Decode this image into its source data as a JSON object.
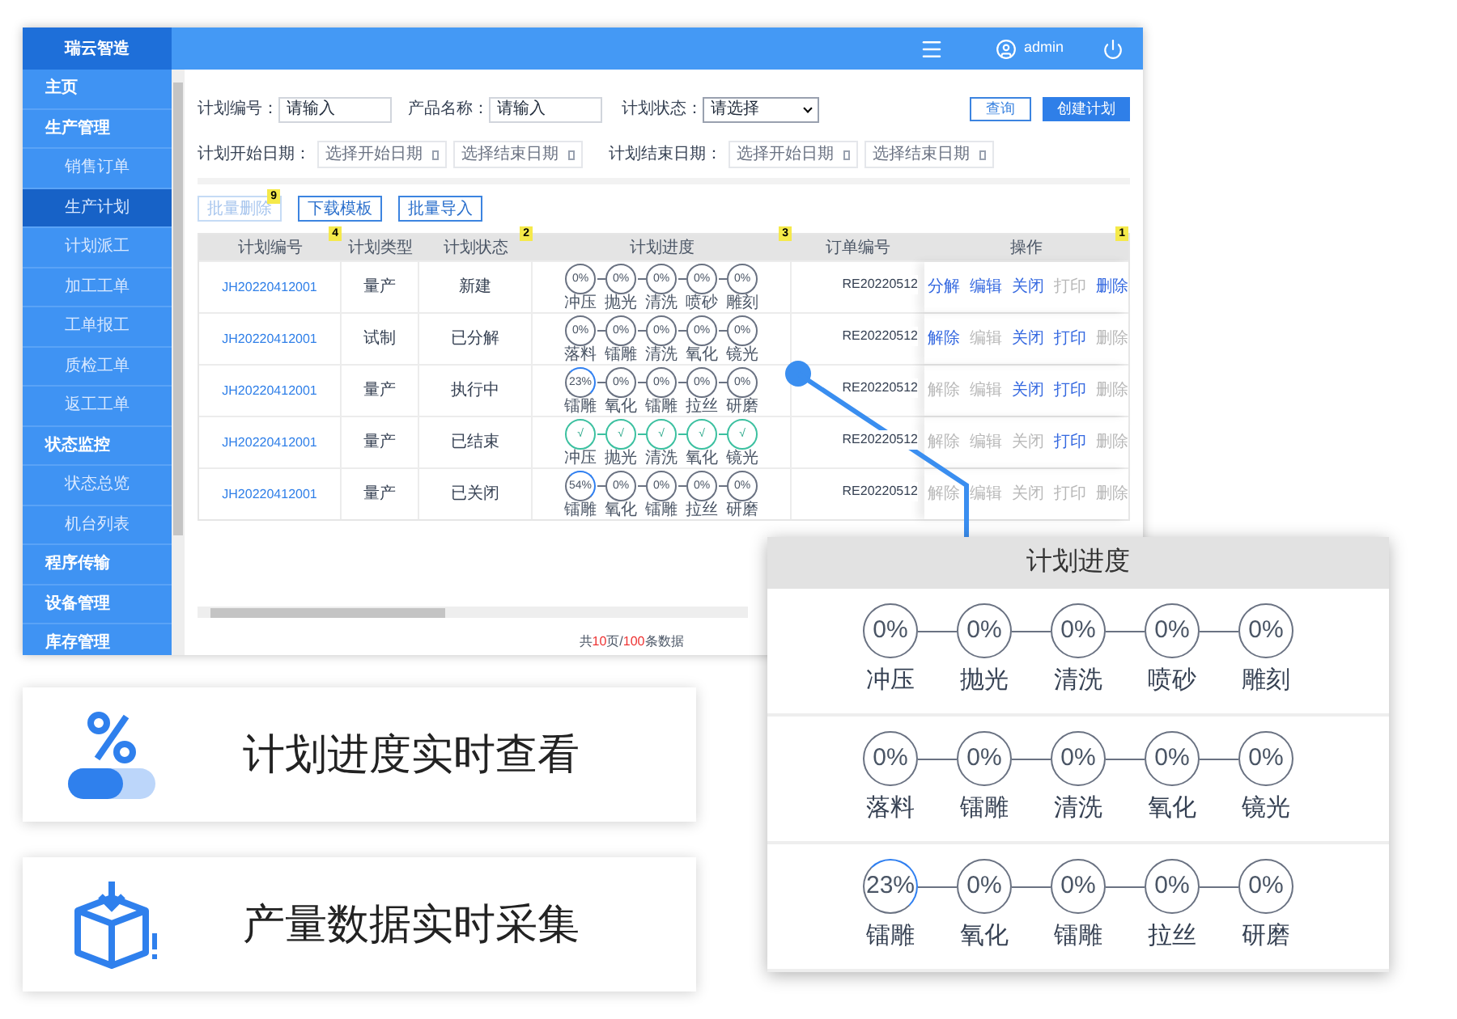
{
  "app": {
    "brand": "瑞云智造",
    "user": "admin",
    "sidebar": [
      {
        "label": "主页",
        "selected": false
      },
      {
        "label": "生产管理",
        "selected": false,
        "children": [
          {
            "label": "销售订单",
            "selected": false
          },
          {
            "label": "生产计划",
            "selected": true
          },
          {
            "label": "计划派工",
            "selected": false
          },
          {
            "label": "加工工单",
            "selected": false
          },
          {
            "label": "工单报工",
            "selected": false
          },
          {
            "label": "质检工单",
            "selected": false
          },
          {
            "label": "返工工单",
            "selected": false
          }
        ]
      },
      {
        "label": "状态监控",
        "selected": false,
        "children": [
          {
            "label": "状态总览",
            "selected": false
          },
          {
            "label": "机台列表",
            "selected": false
          }
        ]
      },
      {
        "label": "程序传输",
        "selected": false
      },
      {
        "label": "设备管理",
        "selected": false
      },
      {
        "label": "库存管理",
        "selected": false
      }
    ],
    "filters": {
      "plan_no": {
        "label": "计划编号：",
        "placeholder": "请输入"
      },
      "product": {
        "label": "产品名称：",
        "placeholder": "请输入"
      },
      "status": {
        "label": "计划状态：",
        "value": "请选择"
      },
      "start_date": {
        "label": "计划开始日期：",
        "from": "选择开始日期",
        "to": "选择结束日期"
      },
      "end_date": {
        "label": "计划结束日期：",
        "from": "选择开始日期",
        "to": "选择结束日期"
      },
      "buttons": [
        {
          "label": "查询",
          "kind": "outline"
        },
        {
          "label": "创建计划",
          "kind": "primary"
        }
      ]
    },
    "actions": [
      {
        "label": "批量删除",
        "disabled": true,
        "badge": "9"
      },
      {
        "label": "下载模板",
        "disabled": false
      },
      {
        "label": "批量导入",
        "disabled": false
      }
    ],
    "table": {
      "columns": [
        {
          "label": "计划编号",
          "badge": "4"
        },
        {
          "label": "计划类型"
        },
        {
          "label": "计划状态",
          "badge": "2"
        },
        {
          "label": "计划进度",
          "badge": "3"
        },
        {
          "label": "订单编号"
        },
        {
          "label": "操作",
          "badge": "1"
        }
      ],
      "rows": [
        {
          "plan_no": "JH20220412001",
          "type": "量产",
          "status": "新建",
          "order": "RE20220512",
          "steps": [
            {
              "label": "冲压",
              "value": "0%",
              "kind": "todo"
            },
            {
              "label": "抛光",
              "value": "0%",
              "kind": "todo"
            },
            {
              "label": "清洗",
              "value": "0%",
              "kind": "todo"
            },
            {
              "label": "喷砂",
              "value": "0%",
              "kind": "todo"
            },
            {
              "label": "雕刻",
              "value": "0%",
              "kind": "todo"
            }
          ],
          "ops": [
            {
              "label": "分解",
              "disabled": false
            },
            {
              "label": "编辑",
              "disabled": false
            },
            {
              "label": "关闭",
              "disabled": false
            },
            {
              "label": "打印",
              "disabled": true
            },
            {
              "label": "删除",
              "disabled": false
            }
          ]
        },
        {
          "plan_no": "JH20220412001",
          "type": "试制",
          "status": "已分解",
          "order": "RE20220512",
          "steps": [
            {
              "label": "落料",
              "value": "0%",
              "kind": "todo"
            },
            {
              "label": "镭雕",
              "value": "0%",
              "kind": "todo"
            },
            {
              "label": "清洗",
              "value": "0%",
              "kind": "todo"
            },
            {
              "label": "氧化",
              "value": "0%",
              "kind": "todo"
            },
            {
              "label": "镜光",
              "value": "0%",
              "kind": "todo"
            }
          ],
          "ops": [
            {
              "label": "解除",
              "disabled": false
            },
            {
              "label": "编辑",
              "disabled": true
            },
            {
              "label": "关闭",
              "disabled": false
            },
            {
              "label": "打印",
              "disabled": false
            },
            {
              "label": "删除",
              "disabled": true
            }
          ]
        },
        {
          "plan_no": "JH20220412001",
          "type": "量产",
          "status": "执行中",
          "order": "RE20220512",
          "steps": [
            {
              "label": "镭雕",
              "value": "23%",
              "kind": "partial"
            },
            {
              "label": "氧化",
              "value": "0%",
              "kind": "todo"
            },
            {
              "label": "镭雕",
              "value": "0%",
              "kind": "todo"
            },
            {
              "label": "拉丝",
              "value": "0%",
              "kind": "todo"
            },
            {
              "label": "研磨",
              "value": "0%",
              "kind": "todo"
            }
          ],
          "ops": [
            {
              "label": "解除",
              "disabled": true
            },
            {
              "label": "编辑",
              "disabled": true
            },
            {
              "label": "关闭",
              "disabled": false
            },
            {
              "label": "打印",
              "disabled": false
            },
            {
              "label": "删除",
              "disabled": true
            }
          ]
        },
        {
          "plan_no": "JH20220412001",
          "type": "量产",
          "status": "已结束",
          "order": "RE20220512",
          "steps": [
            {
              "label": "冲压",
              "value": "√",
              "kind": "done"
            },
            {
              "label": "抛光",
              "value": "√",
              "kind": "done"
            },
            {
              "label": "清洗",
              "value": "√",
              "kind": "done"
            },
            {
              "label": "氧化",
              "value": "√",
              "kind": "done"
            },
            {
              "label": "镜光",
              "value": "√",
              "kind": "done"
            }
          ],
          "ops": [
            {
              "label": "解除",
              "disabled": true
            },
            {
              "label": "编辑",
              "disabled": true
            },
            {
              "label": "关闭",
              "disabled": true
            },
            {
              "label": "打印",
              "disabled": false
            },
            {
              "label": "删除",
              "disabled": true
            }
          ]
        },
        {
          "plan_no": "JH20220412001",
          "type": "量产",
          "status": "已关闭",
          "order": "RE20220512",
          "steps": [
            {
              "label": "镭雕",
              "value": "54%",
              "kind": "partial"
            },
            {
              "label": "氧化",
              "value": "0%",
              "kind": "todo"
            },
            {
              "label": "镭雕",
              "value": "0%",
              "kind": "todo"
            },
            {
              "label": "拉丝",
              "value": "0%",
              "kind": "todo"
            },
            {
              "label": "研磨",
              "value": "0%",
              "kind": "todo"
            }
          ],
          "ops": [
            {
              "label": "解除",
              "disabled": true
            },
            {
              "label": "编辑",
              "disabled": true
            },
            {
              "label": "关闭",
              "disabled": true
            },
            {
              "label": "打印",
              "disabled": true
            },
            {
              "label": "删除",
              "disabled": true
            }
          ]
        }
      ]
    },
    "pagination": [
      {
        "text": "共",
        "highlight": false
      },
      {
        "text": "10",
        "highlight": true
      },
      {
        "text": "页/",
        "highlight": false
      },
      {
        "text": "100",
        "highlight": true
      },
      {
        "text": "条数据",
        "highlight": false
      }
    ]
  },
  "features": [
    {
      "kind": "progress",
      "text": "计划进度实时查看"
    },
    {
      "kind": "collect",
      "text": "产量数据实时采集"
    }
  ],
  "callout": {
    "title": "计划进度",
    "rows": [
      [
        {
          "label": "冲压",
          "value": "0%",
          "kind": "todo"
        },
        {
          "label": "抛光",
          "value": "0%",
          "kind": "todo"
        },
        {
          "label": "清洗",
          "value": "0%",
          "kind": "todo"
        },
        {
          "label": "喷砂",
          "value": "0%",
          "kind": "todo"
        },
        {
          "label": "雕刻",
          "value": "0%",
          "kind": "todo"
        }
      ],
      [
        {
          "label": "落料",
          "value": "0%",
          "kind": "todo"
        },
        {
          "label": "镭雕",
          "value": "0%",
          "kind": "todo"
        },
        {
          "label": "清洗",
          "value": "0%",
          "kind": "todo"
        },
        {
          "label": "氧化",
          "value": "0%",
          "kind": "todo"
        },
        {
          "label": "镜光",
          "value": "0%",
          "kind": "todo"
        }
      ],
      [
        {
          "label": "镭雕",
          "value": "23%",
          "kind": "partial"
        },
        {
          "label": "氧化",
          "value": "0%",
          "kind": "todo"
        },
        {
          "label": "镭雕",
          "value": "0%",
          "kind": "todo"
        },
        {
          "label": "拉丝",
          "value": "0%",
          "kind": "todo"
        },
        {
          "label": "研磨",
          "value": "0%",
          "kind": "todo"
        }
      ]
    ]
  }
}
